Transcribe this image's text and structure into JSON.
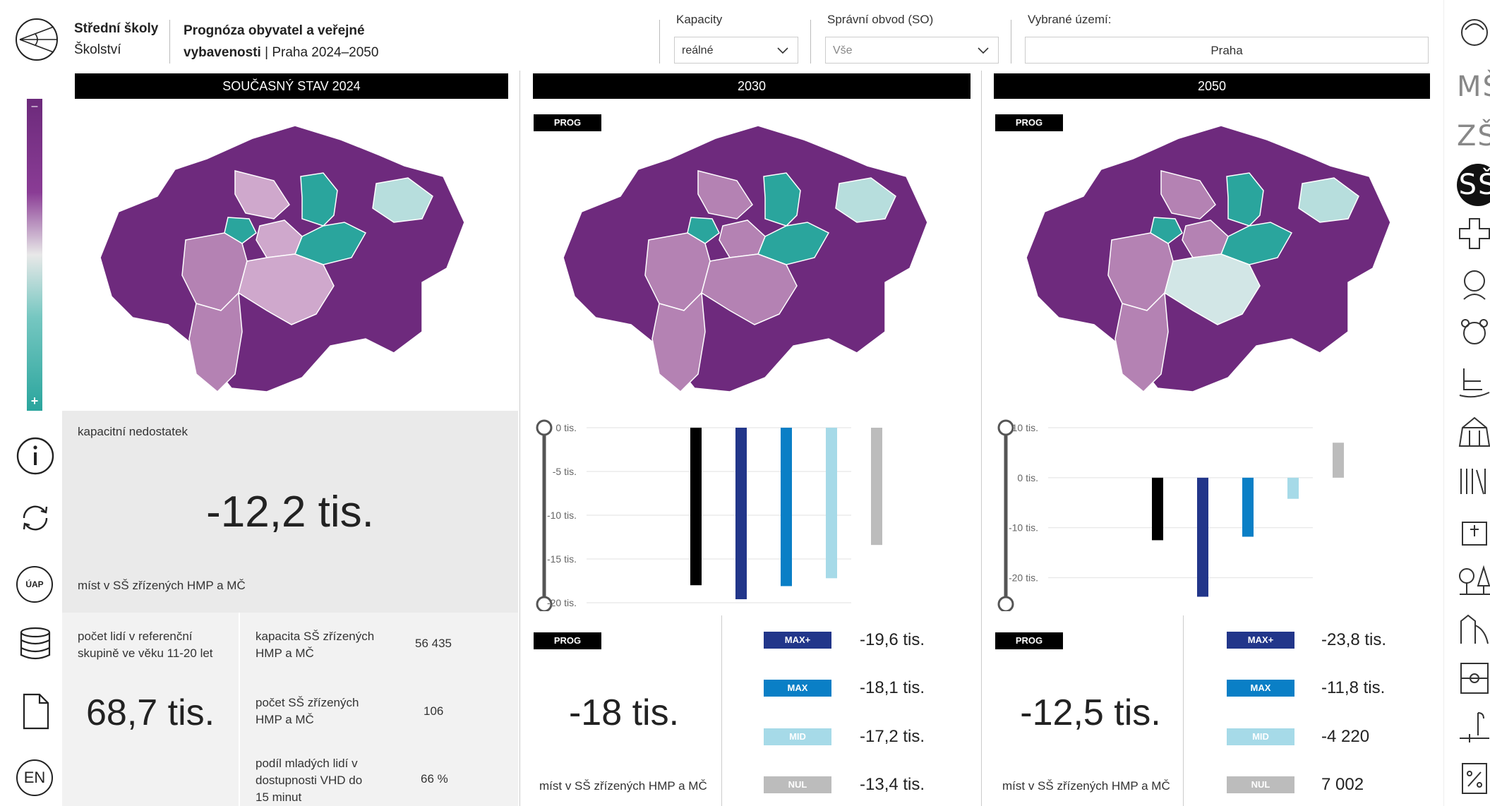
{
  "header": {
    "app_title": "Střední školy",
    "app_sub": "Školství",
    "report_title_bold": "Prognóza obyvatel a veřejné vybavenosti",
    "report_title_rest": " | Praha 2024–2050",
    "filters": [
      {
        "label": "Kapacity",
        "value": "reálné"
      },
      {
        "label": "Správní obvod (SO)",
        "value": "Vše"
      },
      {
        "label": "Vybrané území:",
        "value": "Praha"
      }
    ]
  },
  "legend": {
    "minus": "–",
    "plus": "+"
  },
  "left_icons": {
    "uap": "ÚAP",
    "en": "EN"
  },
  "right_icons": {
    "ms": "MŠ",
    "zs": "ZŠ",
    "ss": "SŠ"
  },
  "colors": {
    "dark_purple": "#6e2a7d",
    "mid_purple": "#b482b3",
    "light_purple": "#cfa8cc",
    "teal": "#2aa59d",
    "light_teal": "#b7dedd",
    "max_plus": "#22368a",
    "max": "#0a7fc6",
    "mid": "#a6dae8",
    "nul": "#bcbcbc"
  },
  "columns": [
    {
      "title": "SOUČASNÝ STAV 2024",
      "kpi_label": "kapacitní nedostatek",
      "kpi_value": "-12,2 tis.",
      "kpi_caption": "míst v SŠ zřízených HMP a MČ",
      "info_left_label": "počet lidí v referenční skupině ve věku 11-20 let",
      "info_left_value": "68,7 tis.",
      "info_rows": [
        {
          "label": "kapacita SŠ zřízených HMP a MČ",
          "value": "56 435"
        },
        {
          "label": "počet SŠ zřízených HMP a MČ",
          "value": "106"
        },
        {
          "label": "podíl mladých lidí v dostupnosti VHD do 15 minut",
          "value": "66 %"
        }
      ]
    },
    {
      "title": "2030",
      "prog": "PROG",
      "kpi_value": "-18 tis.",
      "kpi_caption": "míst v SŠ zřízených HMP a MČ",
      "scenarios": [
        {
          "name": "MAX+",
          "value": "-19,6 tis."
        },
        {
          "name": "MAX",
          "value": "-18,1 tis."
        },
        {
          "name": "MID",
          "value": "-17,2 tis."
        },
        {
          "name": "NUL",
          "value": "-13,4 tis."
        }
      ]
    },
    {
      "title": "2050",
      "prog": "PROG",
      "kpi_value": "-12,5 tis.",
      "kpi_caption": "míst v SŠ zřízených HMP a MČ",
      "scenarios": [
        {
          "name": "MAX+",
          "value": "-23,8 tis."
        },
        {
          "name": "MAX",
          "value": "-11,8 tis."
        },
        {
          "name": "MID",
          "value": "-4 220"
        },
        {
          "name": "NUL",
          "value": "7 002"
        }
      ]
    }
  ],
  "chart_data": [
    {
      "type": "bar",
      "categories": [
        "PROG",
        "MAX+",
        "MAX",
        "MID",
        "NUL"
      ],
      "values": [
        -18.0,
        -19.6,
        -18.1,
        -17.2,
        -13.4
      ],
      "yticks": [
        "0 tis.",
        "-5 tis.",
        "-10 tis.",
        "-15 tis.",
        "-20 tis."
      ],
      "ylim": [
        -20,
        0
      ],
      "colors": [
        "#000000",
        "#22368a",
        "#0a7fc6",
        "#a6dae8",
        "#bcbcbc"
      ]
    },
    {
      "type": "bar",
      "categories": [
        "PROG",
        "MAX+",
        "MAX",
        "MID",
        "NUL"
      ],
      "values": [
        -12.5,
        -23.8,
        -11.8,
        -4.22,
        7.002
      ],
      "yticks": [
        "10 tis.",
        "0 tis.",
        "-10 tis.",
        "-20 tis."
      ],
      "ylim": [
        -25,
        10
      ],
      "colors": [
        "#000000",
        "#22368a",
        "#0a7fc6",
        "#a6dae8",
        "#bcbcbc"
      ]
    }
  ]
}
